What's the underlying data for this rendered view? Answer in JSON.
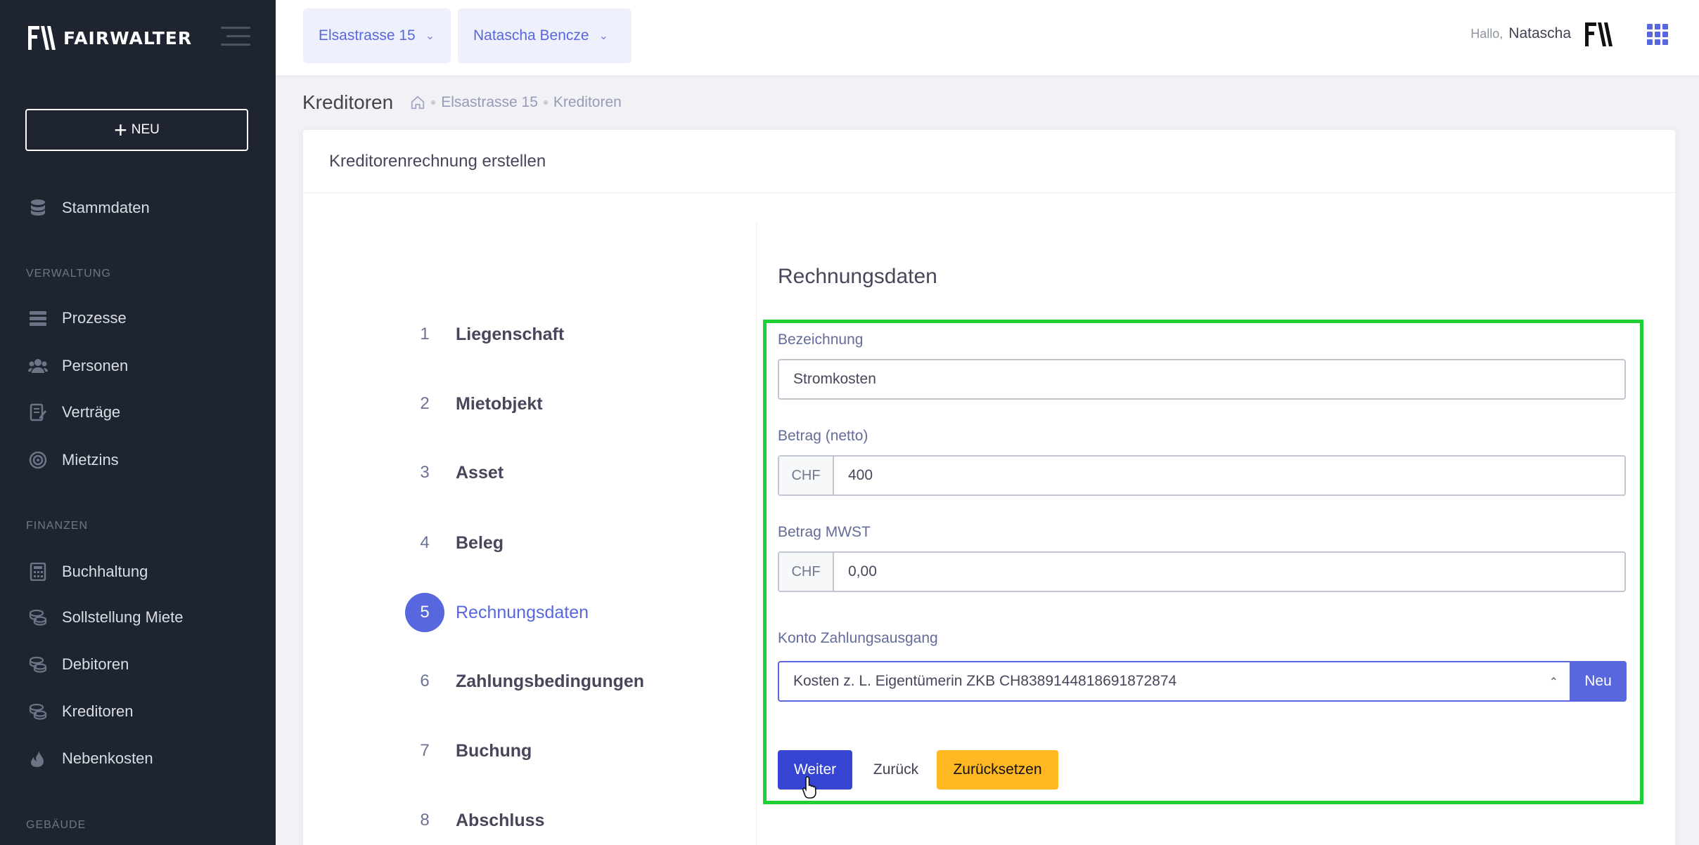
{
  "brand": {
    "name": "FAIRWALTER"
  },
  "sidebar": {
    "new_button": "NEU",
    "items": [
      {
        "label": "Stammdaten",
        "icon": "database-icon"
      },
      {
        "label": "Prozesse",
        "icon": "server-icon"
      },
      {
        "label": "Personen",
        "icon": "people-icon"
      },
      {
        "label": "Verträge",
        "icon": "contract-icon"
      },
      {
        "label": "Mietzins",
        "icon": "target-icon"
      },
      {
        "label": "Buchhaltung",
        "icon": "calculator-icon"
      },
      {
        "label": "Sollstellung Miete",
        "icon": "coins-icon"
      },
      {
        "label": "Debitoren",
        "icon": "coins-icon"
      },
      {
        "label": "Kreditoren",
        "icon": "coins-icon"
      },
      {
        "label": "Nebenkosten",
        "icon": "fire-icon"
      }
    ],
    "sections": [
      "VERWALTUNG",
      "FINANZEN",
      "GEBÄUDE"
    ]
  },
  "topbar": {
    "property_select": "Elsastrasse 15",
    "person_select": "Natascha Bencze",
    "greeting": "Hallo,",
    "user_name": "Natascha"
  },
  "subheader": {
    "title": "Kreditoren",
    "breadcrumb": [
      "Elsastrasse 15",
      "Kreditoren"
    ]
  },
  "card": {
    "title": "Kreditorenrechnung erstellen",
    "steps": [
      {
        "num": "1",
        "label": "Liegenschaft"
      },
      {
        "num": "2",
        "label": "Mietobjekt"
      },
      {
        "num": "3",
        "label": "Asset"
      },
      {
        "num": "4",
        "label": "Beleg"
      },
      {
        "num": "5",
        "label": "Rechnungsdaten"
      },
      {
        "num": "6",
        "label": "Zahlungsbedingungen"
      },
      {
        "num": "7",
        "label": "Buchung"
      },
      {
        "num": "8",
        "label": "Abschluss"
      }
    ],
    "active_step": 5
  },
  "form": {
    "section_title": "Rechnungsdaten",
    "bezeichnung_label": "Bezeichnung",
    "bezeichnung_value": "Stromkosten",
    "betrag_netto_label": "Betrag (netto)",
    "betrag_netto_prefix": "CHF",
    "betrag_netto_value": "400",
    "betrag_mwst_label": "Betrag MWST",
    "betrag_mwst_prefix": "CHF",
    "betrag_mwst_value": "0,00",
    "konto_label": "Konto Zahlungsausgang",
    "konto_value": "Kosten z. L. Eigentümerin ZKB CH8389144818691872874",
    "konto_new_button": "Neu",
    "weiter_button": "Weiter",
    "zurueck_button": "Zurück",
    "zuruecksetzen_button": "Zurücksetzen"
  },
  "colors": {
    "sidebar_bg": "#1e2530",
    "accent": "#5867dd",
    "primary_button": "#3545d1",
    "warning_button": "#ffb822",
    "highlight_border": "#22cf30"
  }
}
